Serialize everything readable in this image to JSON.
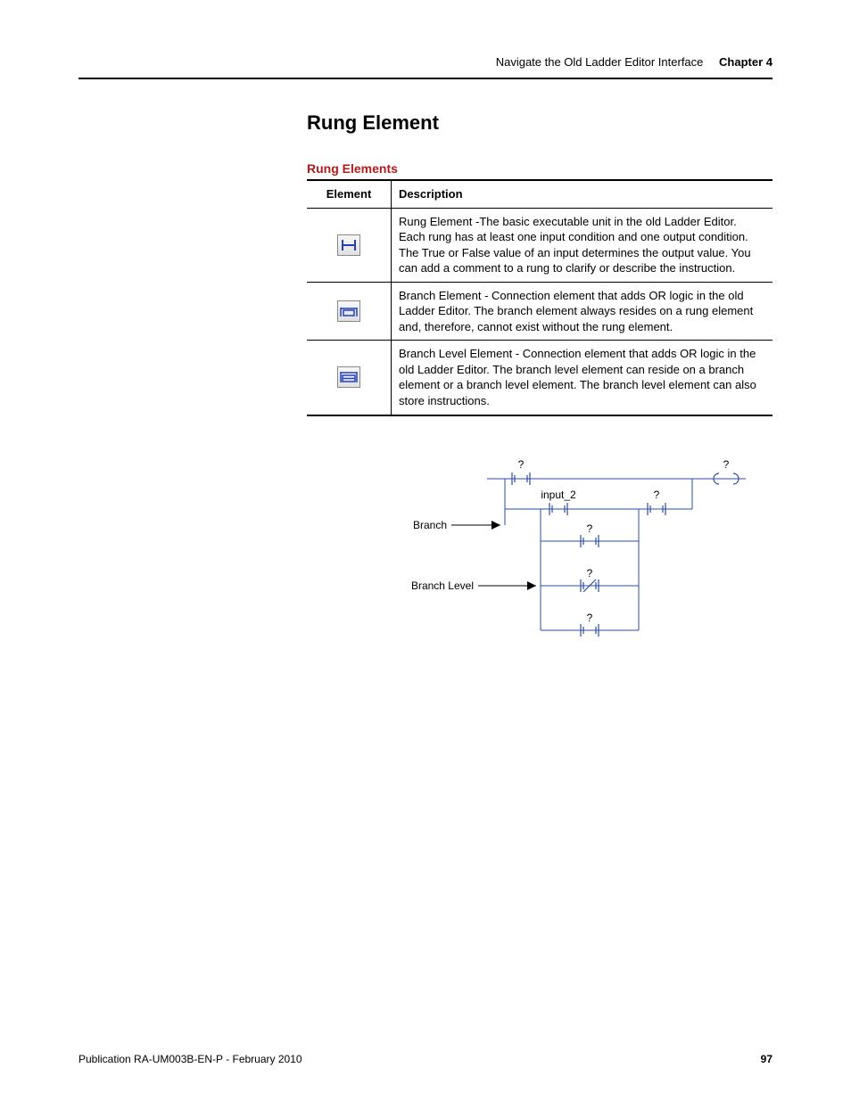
{
  "header": {
    "section_title": "Navigate the Old Ladder Editor Interface",
    "chapter_label": "Chapter 4"
  },
  "section": {
    "heading": "Rung Element",
    "table_caption": "Rung Elements",
    "columns": {
      "element": "Element",
      "description": "Description"
    },
    "rows": [
      {
        "icon": "rung-element-icon",
        "description": "Rung Element -The basic executable unit in the old Ladder Editor. Each rung has at least one input condition and one output condition. The True or False value of an input determines the output value. You can add a comment to a rung to clarify or describe the instruction."
      },
      {
        "icon": "branch-element-icon",
        "description": "Branch Element - Connection element that adds OR logic in the old Ladder Editor. The branch element always resides on a rung element and, therefore, cannot exist without the rung element."
      },
      {
        "icon": "branch-level-element-icon",
        "description": "Branch Level Element - Connection element that adds OR logic in the old Ladder Editor. The branch level element can reside on a branch element or a branch level element. The branch level element can also store instructions."
      }
    ]
  },
  "diagram": {
    "labels": {
      "branch": "Branch",
      "branch_level": "Branch Level",
      "input2": "input_2",
      "q": "?"
    }
  },
  "footer": {
    "publication": "Publication RA-UM003B-EN-P - February 2010",
    "page_number": "97"
  }
}
